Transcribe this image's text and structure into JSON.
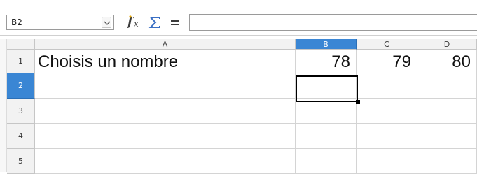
{
  "formula_bar": {
    "name_box": "B2",
    "input_value": ""
  },
  "icons": {
    "function_wizard": "function-wizard-icon",
    "sum": "sum-icon",
    "equals": "formula-equals-icon",
    "dropdown": "chevron-down-icon"
  },
  "columns": [
    "A",
    "B",
    "C",
    "D"
  ],
  "rows": [
    "1",
    "2",
    "3",
    "4",
    "5"
  ],
  "cells": {
    "A1": "Choisis un nombre",
    "B1": "78",
    "C1": "79",
    "D1": "80"
  },
  "selection": {
    "active_cell": "B2"
  },
  "colors": {
    "accent": "#3a86d4",
    "header_bg": "#f2f2f2",
    "grid_line": "#d4d4d4"
  }
}
